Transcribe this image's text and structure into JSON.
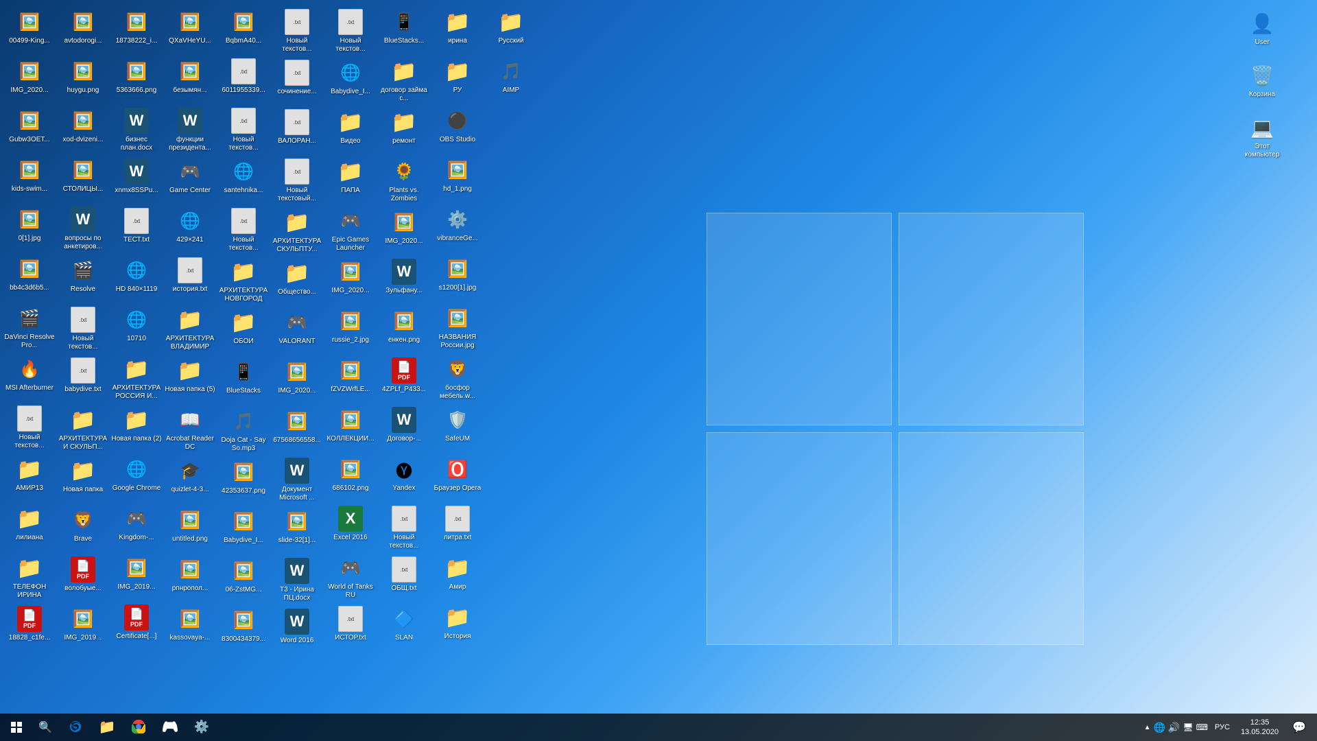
{
  "desktop": {
    "icons": [
      {
        "id": "00499-king",
        "label": "00499-King...",
        "type": "img",
        "emoji": "🖼️"
      },
      {
        "id": "img2020-1",
        "label": "IMG_2020...",
        "type": "img",
        "emoji": "🖼️"
      },
      {
        "id": "gubw3oet",
        "label": "Gubw3OET...",
        "type": "img",
        "emoji": "🖼️"
      },
      {
        "id": "kids-swim",
        "label": "kids-swim...",
        "type": "img",
        "emoji": "🖼️"
      },
      {
        "id": "0l1jpg",
        "label": "0[1].jpg",
        "type": "img",
        "emoji": "🖼️"
      },
      {
        "id": "bb4c3d6b",
        "label": "bb4c3d6b5...",
        "type": "img",
        "emoji": "🖼️"
      },
      {
        "id": "davinci",
        "label": "DaVinci Resolve Pro...",
        "type": "app",
        "emoji": "🎬",
        "color": "#1a1a2e"
      },
      {
        "id": "msi-afterburner",
        "label": "MSI Afterburner",
        "type": "app",
        "emoji": "🔥"
      },
      {
        "id": "noviy-txt1",
        "label": "Новый текстов...",
        "type": "txt",
        "emoji": "📄"
      },
      {
        "id": "amir13",
        "label": "АМИР13",
        "type": "folder",
        "emoji": "📁"
      },
      {
        "id": "liliana",
        "label": "лилиана",
        "type": "folder",
        "emoji": "📁"
      },
      {
        "id": "telefon-irina",
        "label": "ТЕЛЕФОН ИРИНА",
        "type": "folder",
        "emoji": "📁"
      },
      {
        "id": "18828-c1fe",
        "label": "18828_c1fe...",
        "type": "pdf",
        "emoji": "📕"
      },
      {
        "id": "avtodorogi",
        "label": "avtodorogi...",
        "type": "img",
        "emoji": "🖼️"
      },
      {
        "id": "huygu",
        "label": "huygu.png",
        "type": "img",
        "emoji": "🖼️"
      },
      {
        "id": "xod-dvizeni",
        "label": "xod-dvizeni...",
        "type": "img",
        "emoji": "🖼️"
      },
      {
        "id": "stolici",
        "label": "СТОЛИЦЫ...",
        "type": "img",
        "emoji": "🖼️"
      },
      {
        "id": "voprosi",
        "label": "вопросы по анкетиров...",
        "type": "word",
        "emoji": "W"
      },
      {
        "id": "resolve",
        "label": "Resolve",
        "type": "app",
        "emoji": "🎬"
      },
      {
        "id": "noviy-txt2",
        "label": "Новый текстов...",
        "type": "txt",
        "emoji": "📄"
      },
      {
        "id": "babydive-txt",
        "label": "babydive.txt",
        "type": "txt",
        "emoji": "📄"
      },
      {
        "id": "arhitektura-skulp",
        "label": "АРХИТЕКТУРА И СКУЛЬП...",
        "type": "folder",
        "emoji": "📁"
      },
      {
        "id": "novaya-papka",
        "label": "Новая папка",
        "type": "folder",
        "emoji": "📁"
      },
      {
        "id": "brave",
        "label": "Brave",
        "type": "app",
        "emoji": "🦁"
      },
      {
        "id": "volobuye",
        "label": "волобуые...",
        "type": "pdf",
        "emoji": "📕"
      },
      {
        "id": "img2019-1",
        "label": "IMG_2019...",
        "type": "img",
        "emoji": "🖼️"
      },
      {
        "id": "18738222",
        "label": "18738222_i...",
        "type": "img",
        "emoji": "🖼️"
      },
      {
        "id": "5363666",
        "label": "5363666.png",
        "type": "img",
        "emoji": "🖼️"
      },
      {
        "id": "biznes-plan",
        "label": "бизнес план.docx",
        "type": "word",
        "emoji": "W"
      },
      {
        "id": "xnmx8sspu",
        "label": "xnmx8SSPu...",
        "type": "word",
        "emoji": "W"
      },
      {
        "id": "test-txt",
        "label": "ТЕСТ.txt",
        "type": "txt",
        "emoji": "📄"
      },
      {
        "id": "hd840",
        "label": "HD 840×1119",
        "type": "app",
        "emoji": "🌐"
      },
      {
        "id": "10710",
        "label": "10710",
        "type": "app",
        "emoji": "🌐"
      },
      {
        "id": "arhitektura-rossiya",
        "label": "АРХИТЕКТУРА РОССИЯ И...",
        "type": "folder",
        "emoji": "📁"
      },
      {
        "id": "novaya-papka-2",
        "label": "Новая папка (2)",
        "type": "folder",
        "emoji": "📁"
      },
      {
        "id": "google-chrome",
        "label": "Google Chrome",
        "type": "app",
        "emoji": "🌐"
      },
      {
        "id": "kingdom",
        "label": "Kingdom-...",
        "type": "app",
        "emoji": "🎮"
      },
      {
        "id": "img2019-2",
        "label": "IMG_2019...",
        "type": "img",
        "emoji": "🖼️"
      },
      {
        "id": "certificate",
        "label": "Certificate[...]",
        "type": "pdf",
        "emoji": "📕"
      },
      {
        "id": "qxavheyu",
        "label": "QXaVHeYU...",
        "type": "img",
        "emoji": "🖼️"
      },
      {
        "id": "bezimyanniy",
        "label": "безымян...",
        "type": "img",
        "emoji": "🖼️"
      },
      {
        "id": "funkcii-prezidenta",
        "label": "функции президента...",
        "type": "word",
        "emoji": "W"
      },
      {
        "id": "game-center",
        "label": "Game Center",
        "type": "app",
        "emoji": "🎮"
      },
      {
        "id": "429x241",
        "label": "429×241",
        "type": "app",
        "emoji": "🌐"
      },
      {
        "id": "istoriya-txt",
        "label": "история.txt",
        "type": "txt",
        "emoji": "📄"
      },
      {
        "id": "arhitektura-vladimir",
        "label": "АРХИТЕКТУРА ВЛАДИМИР",
        "type": "folder",
        "emoji": "📁"
      },
      {
        "id": "novaya-papka-5",
        "label": "Новая папка (5)",
        "type": "folder",
        "emoji": "📁"
      },
      {
        "id": "acrobat",
        "label": "Acrobat Reader DC",
        "type": "app",
        "emoji": "📖"
      },
      {
        "id": "quizlet",
        "label": "quizlet-4-3...",
        "type": "app",
        "emoji": "🎓"
      },
      {
        "id": "untitled",
        "label": "untitled.png",
        "type": "img",
        "emoji": "🖼️"
      },
      {
        "id": "pnprop",
        "label": "рпнропол...",
        "type": "img",
        "emoji": "🖼️"
      },
      {
        "id": "kassovaya",
        "label": "kassovaya-...",
        "type": "img",
        "emoji": "🖼️"
      },
      {
        "id": "bqbma40",
        "label": "BqbmA40...",
        "type": "img",
        "emoji": "🖼️"
      },
      {
        "id": "6011955339",
        "label": "6011955339...",
        "type": "txt",
        "emoji": "📄"
      },
      {
        "id": "noviy-txt3",
        "label": "Новый текстов...",
        "type": "txt",
        "emoji": "📄"
      },
      {
        "id": "santehnika",
        "label": "santehnika...",
        "type": "app",
        "emoji": "🌐"
      },
      {
        "id": "noviy-txt4",
        "label": "Новый текстов...",
        "type": "txt",
        "emoji": "📄"
      },
      {
        "id": "arhitektura-novgorod",
        "label": "АРХИТЕКТУРА НОВГОРОД",
        "type": "folder",
        "emoji": "📁"
      },
      {
        "id": "oboi",
        "label": "ОБОИ",
        "type": "folder",
        "emoji": "📁"
      },
      {
        "id": "bluestacks",
        "label": "BlueStacks",
        "type": "app",
        "emoji": "📱"
      },
      {
        "id": "doja-cat",
        "label": "Doja Cat - Say So.mp3",
        "type": "app",
        "emoji": "🎵"
      },
      {
        "id": "42353637",
        "label": "42353637.png",
        "type": "img",
        "emoji": "🖼️"
      },
      {
        "id": "babydive-img",
        "label": "Babydive_I...",
        "type": "img",
        "emoji": "🖼️"
      },
      {
        "id": "06-zstmg",
        "label": "06-ZstMG...",
        "type": "img",
        "emoji": "🖼️"
      },
      {
        "id": "8300434",
        "label": "8300434379...",
        "type": "img",
        "emoji": "🖼️"
      },
      {
        "id": "noviy-txt5",
        "label": "Новый текстов...",
        "type": "txt",
        "emoji": "📄"
      },
      {
        "id": "sochinenie",
        "label": "сочинение...",
        "type": "txt",
        "emoji": "📄"
      },
      {
        "id": "valorant-txt",
        "label": "ВАЛОРАН...",
        "type": "txt",
        "emoji": "📄"
      },
      {
        "id": "noviy-txt6",
        "label": "Новый текстовый...",
        "type": "txt",
        "emoji": "📄"
      },
      {
        "id": "arhitektura-sculp",
        "label": "АРХИТЕКТУРА СКУЛЬПТУ...",
        "type": "folder",
        "emoji": "📁"
      },
      {
        "id": "obschestvo",
        "label": "Общество...",
        "type": "folder",
        "emoji": "📁"
      },
      {
        "id": "valorant",
        "label": "VALORANT",
        "type": "app",
        "emoji": "🎮"
      },
      {
        "id": "img2020-2",
        "label": "IMG_2020...",
        "type": "img",
        "emoji": "🖼️"
      },
      {
        "id": "67568656",
        "label": "67568656558...",
        "type": "img",
        "emoji": "🖼️"
      },
      {
        "id": "dokument-ms",
        "label": "Документ Microsoft ...",
        "type": "word",
        "emoji": "W"
      },
      {
        "id": "slide-32",
        "label": "slide-32[1]...",
        "type": "img",
        "emoji": "🖼️"
      },
      {
        "id": "t3-irina",
        "label": "Т3 - Ирина ПЦ.docx",
        "type": "word",
        "emoji": "W"
      },
      {
        "id": "word-2016",
        "label": "Word 2016",
        "type": "word-app",
        "emoji": "W"
      },
      {
        "id": "noviy-txt7",
        "label": "Новый текстов...",
        "type": "txt",
        "emoji": "📄"
      },
      {
        "id": "babydive-img2",
        "label": "Babydive_I...",
        "type": "app",
        "emoji": "🌐"
      },
      {
        "id": "video",
        "label": "Видео",
        "type": "folder",
        "emoji": "📁"
      },
      {
        "id": "papa",
        "label": "ПАПА",
        "type": "folder",
        "emoji": "📁"
      },
      {
        "id": "epic-games",
        "label": "Epic Games Launcher",
        "type": "app",
        "emoji": "🎮"
      },
      {
        "id": "img2020-3",
        "label": "IMG_2020...",
        "type": "img",
        "emoji": "🖼️"
      },
      {
        "id": "russie-2",
        "label": "russie_2.jpg",
        "type": "img",
        "emoji": "🖼️"
      },
      {
        "id": "fzvzwrle",
        "label": "fZVZWrfLE...",
        "type": "img",
        "emoji": "🖼️"
      },
      {
        "id": "kollekcii",
        "label": "КОЛЛЕКЦИИ...",
        "type": "img",
        "emoji": "🖼️"
      },
      {
        "id": "686102",
        "label": "686102.png",
        "type": "img",
        "emoji": "🖼️"
      },
      {
        "id": "excel-2016",
        "label": "Excel 2016",
        "type": "excel-app",
        "emoji": "X"
      },
      {
        "id": "world-of-tanks",
        "label": "World of Tanks RU",
        "type": "app",
        "emoji": "🎮"
      },
      {
        "id": "istor-txt",
        "label": "ИСТОР.txt",
        "type": "txt",
        "emoji": "📄"
      },
      {
        "id": "bluestacks-app",
        "label": "BlueStacks...",
        "type": "app",
        "emoji": "📱"
      },
      {
        "id": "dogovor-zaima",
        "label": "договор займа с...",
        "type": "folder",
        "emoji": "📁"
      },
      {
        "id": "remont",
        "label": "ремонт",
        "type": "folder",
        "emoji": "📁"
      },
      {
        "id": "plants-zombies",
        "label": "Plants vs. Zombies",
        "type": "app",
        "emoji": "🌻"
      },
      {
        "id": "img2020-4",
        "label": "IMG_2020...",
        "type": "img",
        "emoji": "🖼️"
      },
      {
        "id": "zulfanu",
        "label": "Зульфану...",
        "type": "word",
        "emoji": "W"
      },
      {
        "id": "enken",
        "label": "енкен.png",
        "type": "img",
        "emoji": "🖼️"
      },
      {
        "id": "4zplf-p433",
        "label": "4ZPLf_P433...",
        "type": "pdf",
        "emoji": "📕"
      },
      {
        "id": "dogovor",
        "label": "Договор-...",
        "type": "word",
        "emoji": "W"
      },
      {
        "id": "yandex",
        "label": "Yandex",
        "type": "app",
        "emoji": "🅨"
      },
      {
        "id": "noviy-txt8",
        "label": "Новый текстов...",
        "type": "txt",
        "emoji": "📄"
      },
      {
        "id": "obsch-txt",
        "label": "ОБЩ.txt",
        "type": "txt",
        "emoji": "📄"
      },
      {
        "id": "slan",
        "label": "SLAN",
        "type": "app",
        "emoji": "🔷"
      },
      {
        "id": "irina-folder",
        "label": "ирина",
        "type": "folder",
        "emoji": "📁"
      },
      {
        "id": "ru-folder",
        "label": "РУ",
        "type": "folder",
        "emoji": "📁"
      },
      {
        "id": "obs-studio",
        "label": "OBS Studio",
        "type": "app",
        "emoji": "⚫"
      },
      {
        "id": "hd1",
        "label": "hd_1.png",
        "type": "img",
        "emoji": "🖼️"
      },
      {
        "id": "vibrancege",
        "label": "vibranceGe...",
        "type": "app",
        "emoji": "⚙️"
      },
      {
        "id": "s1200-1",
        "label": "s1200[1].jpg",
        "type": "img",
        "emoji": "🖼️"
      },
      {
        "id": "nazvaniya-rossii",
        "label": "НАЗВАНИЯ России.jpg",
        "type": "img",
        "emoji": "🖼️"
      },
      {
        "id": "bosfur",
        "label": "босфор мебель.w...",
        "type": "app",
        "emoji": "🦁"
      },
      {
        "id": "safeup",
        "label": "SafeUM",
        "type": "app",
        "emoji": "🛡️"
      },
      {
        "id": "brauzer-opera",
        "label": "Браузер Opera",
        "type": "app",
        "emoji": "🅾️"
      },
      {
        "id": "litra-txt",
        "label": "литра.txt",
        "type": "txt",
        "emoji": "📄"
      },
      {
        "id": "amir-folder",
        "label": "Амир",
        "type": "folder",
        "emoji": "📁"
      },
      {
        "id": "istoriya-folder",
        "label": "История",
        "type": "folder",
        "emoji": "📁"
      },
      {
        "id": "russkiy-folder",
        "label": "Русский",
        "type": "folder",
        "emoji": "📁"
      },
      {
        "id": "aimp",
        "label": "AIMP",
        "type": "app",
        "emoji": "🎵"
      }
    ],
    "right_icons": [
      {
        "id": "user",
        "label": "User",
        "type": "folder",
        "emoji": "👤"
      },
      {
        "id": "korzina",
        "label": "Корзина",
        "type": "app",
        "emoji": "🗑️"
      },
      {
        "id": "etot-komputer",
        "label": "Этот компьютер",
        "type": "app",
        "emoji": "💻"
      }
    ]
  },
  "taskbar": {
    "start_icon": "⊞",
    "search_icon": "🔍",
    "apps": [
      {
        "id": "edge",
        "emoji": "🌐",
        "label": "Edge",
        "active": false
      },
      {
        "id": "explorer",
        "emoji": "📁",
        "label": "Explorer",
        "active": false
      },
      {
        "id": "chrome",
        "emoji": "🌐",
        "label": "Chrome",
        "active": false
      },
      {
        "id": "steam",
        "emoji": "🎮",
        "label": "Steam",
        "active": false
      },
      {
        "id": "settings",
        "emoji": "⚙️",
        "label": "Settings",
        "active": false
      }
    ],
    "system_icons": [
      "🔼",
      "🔋",
      "🔊",
      "🖥️",
      "⌨️"
    ],
    "lang": "РУС",
    "time": "12:35",
    "date": "13.05.2020",
    "notification_icon": "💬"
  }
}
